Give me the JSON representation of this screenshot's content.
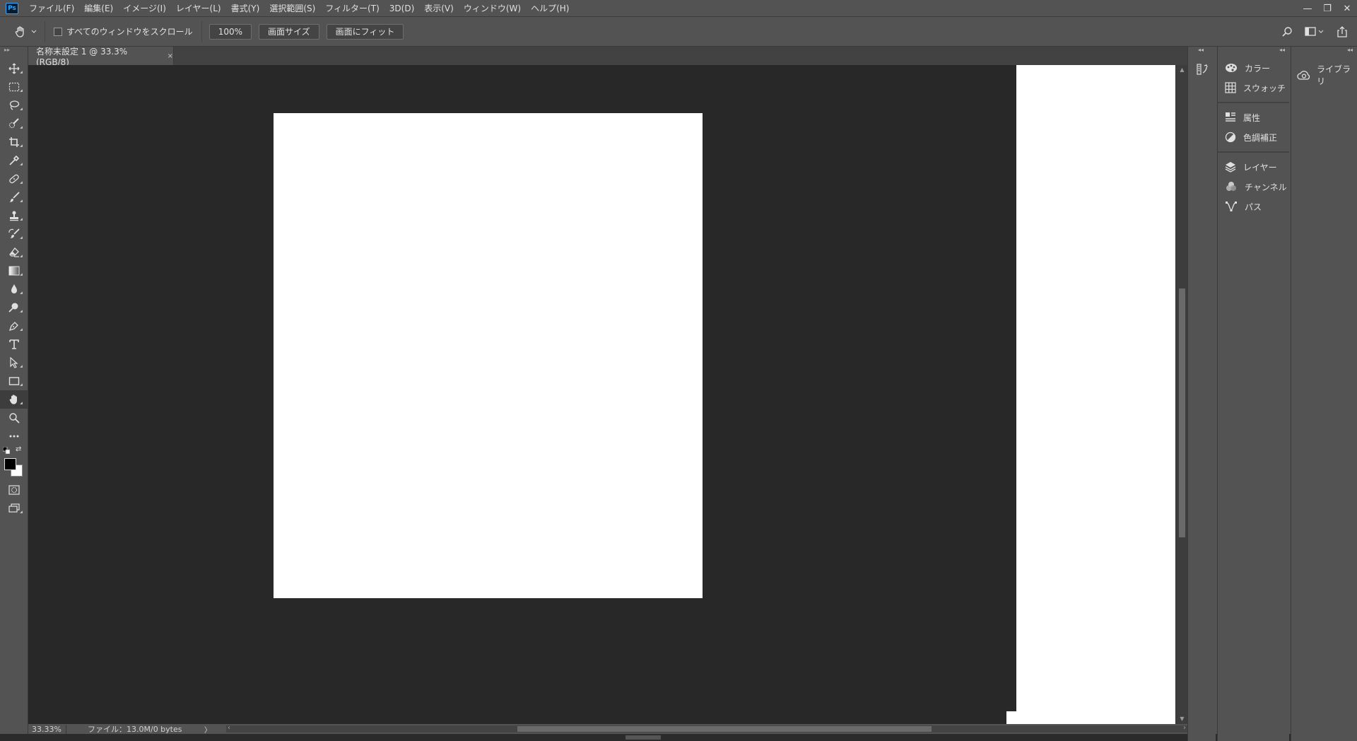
{
  "app": {
    "logo_text": "Ps"
  },
  "menu": {
    "items": [
      {
        "label": "ファイル(F)"
      },
      {
        "label": "編集(E)"
      },
      {
        "label": "イメージ(I)"
      },
      {
        "label": "レイヤー(L)"
      },
      {
        "label": "書式(Y)"
      },
      {
        "label": "選択範囲(S)"
      },
      {
        "label": "フィルター(T)"
      },
      {
        "label": "3D(D)"
      },
      {
        "label": "表示(V)"
      },
      {
        "label": "ウィンドウ(W)"
      },
      {
        "label": "ヘルプ(H)"
      }
    ]
  },
  "window_controls": {
    "minimize": "—",
    "restore": "❐",
    "close": "✕"
  },
  "options_bar": {
    "scroll_all_label": "すべてのウィンドウをスクロール",
    "scroll_all_checked": false,
    "zoom_100_label": "100%",
    "fit_screen_label": "画面サイズ",
    "fill_screen_label": "画面にフィット"
  },
  "document": {
    "tab_title": "名称未設定 1 @ 33.3% (RGB/8)",
    "tab_close": "×"
  },
  "status": {
    "zoom": "33.33%",
    "file_info": "ファイル：13.0M/0 bytes",
    "arrow": "〉",
    "scroll_left": "‹",
    "scroll_right": "›"
  },
  "tools": [
    {
      "name": "move-tool",
      "icon": "move-icon"
    },
    {
      "name": "marquee-tool",
      "icon": "marquee-icon"
    },
    {
      "name": "lasso-tool",
      "icon": "lasso-icon"
    },
    {
      "name": "quick-select-tool",
      "icon": "quick-select-icon"
    },
    {
      "name": "crop-tool",
      "icon": "crop-icon"
    },
    {
      "name": "eyedropper-tool",
      "icon": "eyedropper-icon"
    },
    {
      "name": "healing-brush-tool",
      "icon": "bandage-icon"
    },
    {
      "name": "brush-tool",
      "icon": "brush-icon"
    },
    {
      "name": "clone-stamp-tool",
      "icon": "stamp-icon"
    },
    {
      "name": "history-brush-tool",
      "icon": "history-brush-icon"
    },
    {
      "name": "eraser-tool",
      "icon": "eraser-icon"
    },
    {
      "name": "gradient-tool",
      "icon": "gradient-icon"
    },
    {
      "name": "blur-tool",
      "icon": "drop-icon"
    },
    {
      "name": "dodge-tool",
      "icon": "dodge-icon"
    },
    {
      "name": "pen-tool",
      "icon": "pen-icon"
    },
    {
      "name": "type-tool",
      "icon": "type-icon"
    },
    {
      "name": "path-select-tool",
      "icon": "arrow-icon"
    },
    {
      "name": "rectangle-tool",
      "icon": "rectangle-icon"
    },
    {
      "name": "hand-tool",
      "icon": "hand-icon",
      "active": true
    },
    {
      "name": "zoom-tool",
      "icon": "zoom-icon"
    },
    {
      "name": "more-tools",
      "icon": "ellipsis-icon"
    }
  ],
  "colors": {
    "foreground": "#000000",
    "background": "#ffffff",
    "ui_bg": "#535353",
    "canvas_bg": "#282828"
  },
  "right_panels": {
    "groups": [
      [
        {
          "label": "カラー",
          "icon": "color-palette-icon"
        },
        {
          "label": "スウォッチ",
          "icon": "swatches-grid-icon"
        }
      ],
      [
        {
          "label": "属性",
          "icon": "properties-icon"
        },
        {
          "label": "色調補正",
          "icon": "adjustments-icon"
        }
      ],
      [
        {
          "label": "レイヤー",
          "icon": "layers-icon"
        },
        {
          "label": "チャンネル",
          "icon": "channels-icon"
        },
        {
          "label": "パス",
          "icon": "paths-icon"
        }
      ]
    ],
    "libraries_label": "ライブラリ"
  }
}
